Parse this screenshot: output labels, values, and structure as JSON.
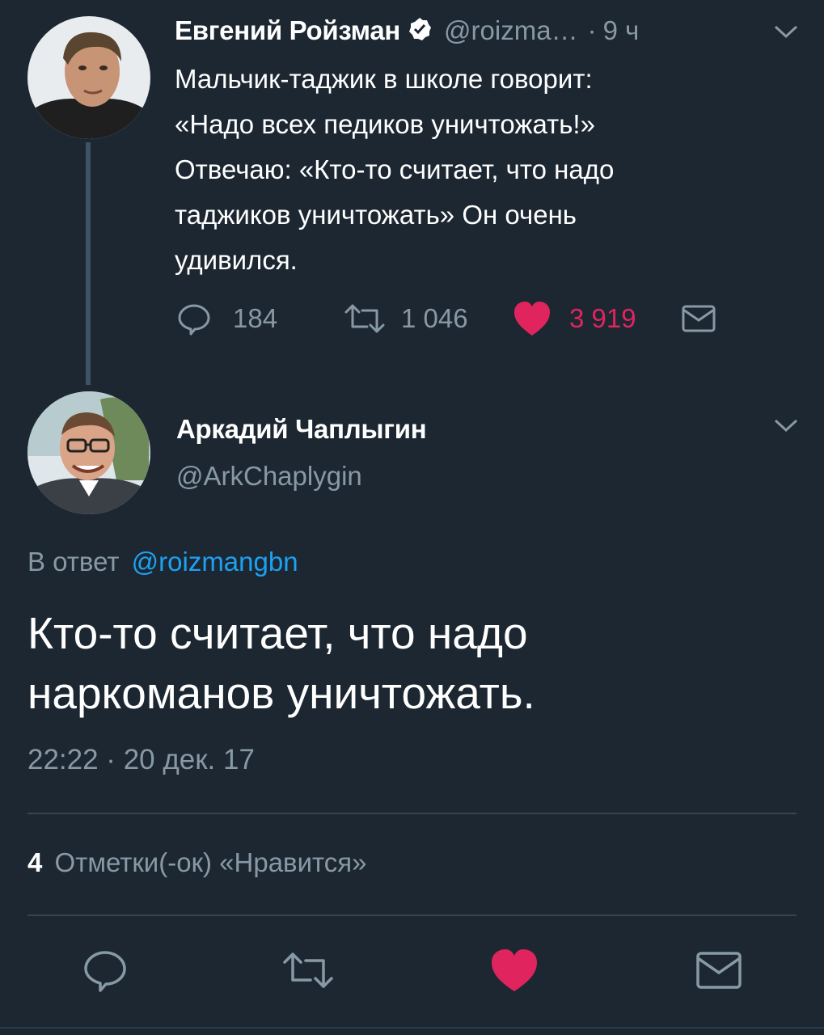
{
  "tweet1": {
    "author_name": "Евгений Ройзман",
    "verified": true,
    "handle": "@roizma…",
    "sep": "·",
    "time_ago": "9 ч",
    "text_lines": [
      "Мальчик-таджик в школе говорит:",
      "«Надо всех педиков уничтожать!»",
      "Отвечаю: «Кто-то считает, что надо",
      "таджиков уничтожать» Он очень",
      "удивился."
    ],
    "actions": {
      "replies": "184",
      "retweets": "1 046",
      "likes": "3 919"
    }
  },
  "tweet2": {
    "author_name": "Аркадий Чаплыгин",
    "handle": "@ArkChaplygin",
    "reply_to_prefix": "В ответ",
    "reply_to_handle": "@roizmangbn",
    "text_lines": [
      "Кто-то считает, что надо",
      "наркоманов уничтожать."
    ],
    "timestamp": "22:22 · 20 дек. 17",
    "likes_count": "4",
    "likes_label": "Отметки(-ок) «Нравится»"
  },
  "icons": [
    "reply-icon",
    "retweet-icon",
    "heart-icon",
    "dm-icon",
    "chevron-down-icon",
    "verified-icon"
  ],
  "colors": {
    "background": "#1c2732",
    "text": "#ffffff",
    "muted": "#8899a6",
    "like": "#e0245e",
    "link": "#1da1f2",
    "divider": "#38444d"
  }
}
